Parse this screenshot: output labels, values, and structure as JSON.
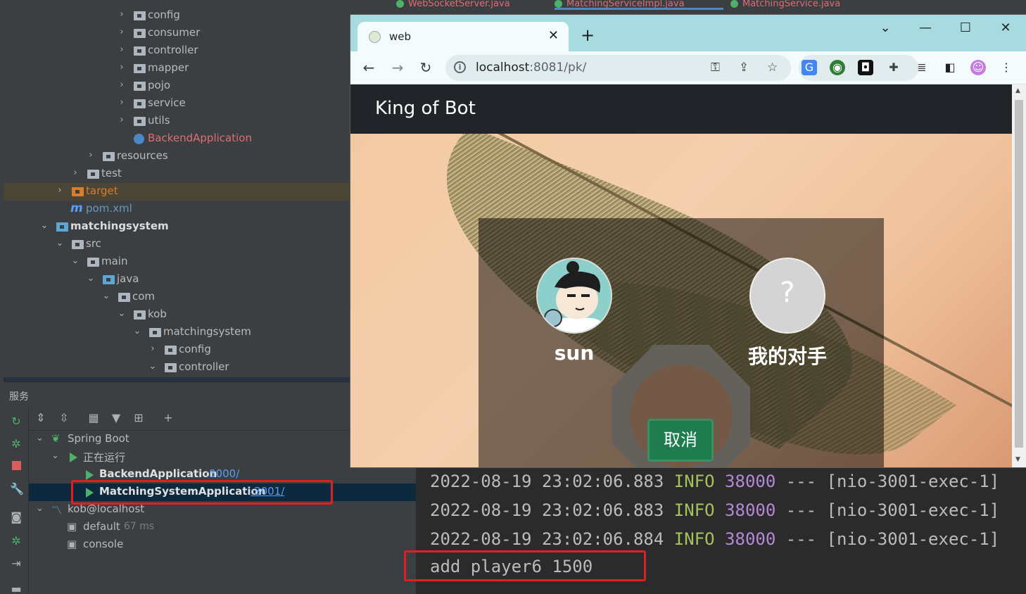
{
  "ide": {
    "editor_tabs": [
      "WebSocketServer.java",
      "MatchingServiceImpl.java",
      "MatchingService.java"
    ],
    "project_tree": [
      {
        "label": "config",
        "indent": 5,
        "icon": "folder",
        "expand": "collapsed"
      },
      {
        "label": "consumer",
        "indent": 5,
        "icon": "folder",
        "expand": "collapsed"
      },
      {
        "label": "controller",
        "indent": 5,
        "icon": "folder",
        "expand": "collapsed"
      },
      {
        "label": "mapper",
        "indent": 5,
        "icon": "folder",
        "expand": "collapsed"
      },
      {
        "label": "pojo",
        "indent": 5,
        "icon": "folder",
        "expand": "collapsed"
      },
      {
        "label": "service",
        "indent": 5,
        "icon": "folder",
        "expand": "collapsed"
      },
      {
        "label": "utils",
        "indent": 5,
        "icon": "folder",
        "expand": "collapsed"
      },
      {
        "label": "BackendApplication",
        "indent": 5,
        "icon": "spring-class",
        "expand": "none",
        "color": "#e06c75"
      },
      {
        "label": "resources",
        "indent": 3,
        "icon": "folder",
        "expand": "collapsed"
      },
      {
        "label": "test",
        "indent": 2,
        "icon": "folder",
        "expand": "collapsed"
      },
      {
        "label": "target",
        "indent": 1,
        "icon": "folder-orange",
        "expand": "collapsed",
        "color": "#d97d2a",
        "highlight": true
      },
      {
        "label": "pom.xml",
        "indent": 1,
        "icon": "maven",
        "expand": "none",
        "color": "#6897bb"
      },
      {
        "label": "matchingsystem",
        "indent": 0,
        "icon": "module",
        "expand": "expanded",
        "bold": true
      },
      {
        "label": "src",
        "indent": 1,
        "icon": "folder",
        "expand": "expanded"
      },
      {
        "label": "main",
        "indent": 2,
        "icon": "folder",
        "expand": "expanded"
      },
      {
        "label": "java",
        "indent": 3,
        "icon": "folder-blue",
        "expand": "expanded"
      },
      {
        "label": "com",
        "indent": 4,
        "icon": "folder",
        "expand": "expanded"
      },
      {
        "label": "kob",
        "indent": 5,
        "icon": "folder",
        "expand": "expanded"
      },
      {
        "label": "matchingsystem",
        "indent": 6,
        "icon": "folder",
        "expand": "expanded"
      },
      {
        "label": "config",
        "indent": 7,
        "icon": "folder",
        "expand": "collapsed"
      },
      {
        "label": "controller",
        "indent": 7,
        "icon": "folder",
        "expand": "expanded"
      }
    ],
    "services": {
      "title": "服务",
      "spring_boot": "Spring Boot",
      "running": "正在运行",
      "apps": [
        {
          "name": "BackendApplication",
          "port": ":3000/"
        },
        {
          "name": "MatchingSystemApplication",
          "port": ":3001/"
        }
      ],
      "db": "kob@localhost",
      "db_children": [
        {
          "name": "default",
          "extra": "67 ms"
        },
        {
          "name": "console",
          "extra": ""
        }
      ]
    },
    "console_lines": [
      {
        "ts": "2022-08-19 23:02:06.883",
        "level": "INFO",
        "pid": "38000",
        "sep": "---",
        "thread": "[nio-3001-exec-1]"
      },
      {
        "ts": "2022-08-19 23:02:06.883",
        "level": "INFO",
        "pid": "38000",
        "sep": "---",
        "thread": "[nio-3001-exec-1]"
      },
      {
        "ts": "2022-08-19 23:02:06.884",
        "level": "INFO",
        "pid": "38000",
        "sep": "---",
        "thread": "[nio-3001-exec-1]"
      }
    ],
    "console_output": "add player6 1500"
  },
  "browser": {
    "tab_title": "web",
    "url_host": "localhost",
    "url_rest": ":8081/pk/",
    "page": {
      "brand": "King of Bot",
      "me": {
        "name": "sun"
      },
      "opponent": {
        "name": "我的对手",
        "placeholder": "?"
      },
      "cancel_label": "取消"
    }
  },
  "colors": {
    "ide_bg": "#3c3f41",
    "console_bg": "#2b2b2b",
    "browser_tabstrip": "#a8dbe0",
    "navbar": "#212529",
    "cancel_button": "#1e7c4f",
    "annotation_red": "#e02020",
    "running_green": "#4fb06a",
    "link_blue": "#589df6"
  }
}
